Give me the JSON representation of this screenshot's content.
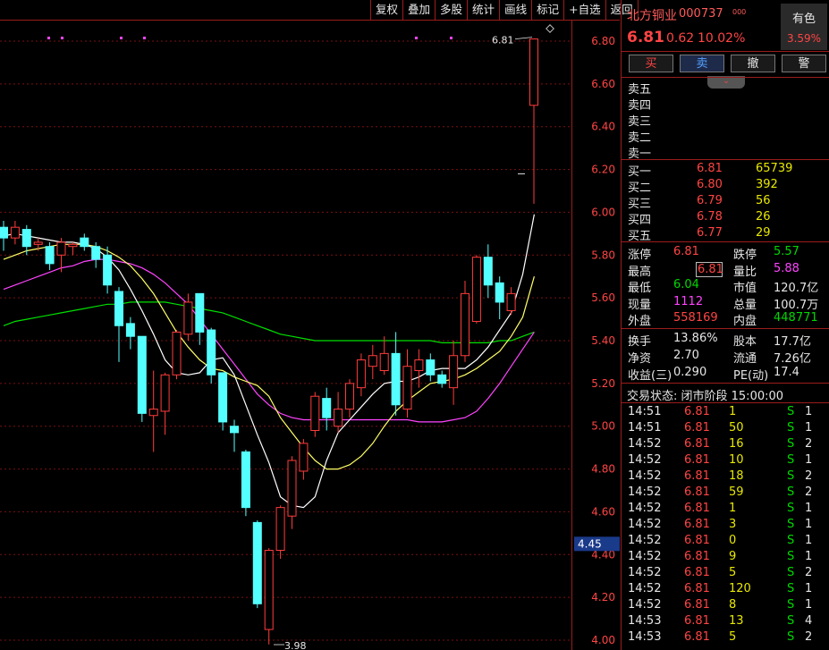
{
  "toolbar": [
    "复权",
    "叠加",
    "多股",
    "统计",
    "画线",
    "标记",
    "+自选",
    "返回"
  ],
  "stock": {
    "name": "北方铜业",
    "code": "000737",
    "sup": "000",
    "price": "6.81",
    "change": "0.62",
    "pct": "10.02%",
    "tag_label": "有色",
    "tag_pct": "3.59%"
  },
  "trade_buttons": [
    "买",
    "卖",
    "撤",
    "警"
  ],
  "sell_levels": [
    "卖五",
    "卖四",
    "卖三",
    "卖二",
    "卖一"
  ],
  "buy_levels": [
    {
      "label": "买一",
      "price": "6.81",
      "vol": "65739"
    },
    {
      "label": "买二",
      "price": "6.80",
      "vol": "392"
    },
    {
      "label": "买三",
      "price": "6.79",
      "vol": "56"
    },
    {
      "label": "买四",
      "price": "6.78",
      "vol": "26"
    },
    {
      "label": "买五",
      "price": "6.77",
      "vol": "29"
    }
  ],
  "stats": [
    {
      "l1": "涨停",
      "v1": "6.81",
      "c1": "red",
      "l2": "跌停",
      "v2": "5.57",
      "c2": "green"
    },
    {
      "l1": "最高",
      "v1": "6.81",
      "c1": "red",
      "l2": "量比",
      "v2": "5.88",
      "c2": "mag",
      "box": true
    },
    {
      "l1": "最低",
      "v1": "6.04",
      "c1": "green",
      "l2": "市值",
      "v2": "120.7亿",
      "c2": "white"
    },
    {
      "l1": "现量",
      "v1": "1112",
      "c1": "mag",
      "l2": "总量",
      "v2": "100.7万",
      "c2": "white"
    },
    {
      "l1": "外盘",
      "v1": "558169",
      "c1": "red",
      "l2": "内盘",
      "v2": "448771",
      "c2": "green"
    }
  ],
  "stats2": [
    {
      "l1": "换手",
      "v1": "13.86%",
      "l2": "股本",
      "v2": "17.7亿"
    },
    {
      "l1": "净资",
      "v1": "2.70",
      "l2": "流通",
      "v2": "7.26亿"
    },
    {
      "l1": "收益(三)",
      "v1": "0.290",
      "l2": "PE(动)",
      "v2": "17.4"
    }
  ],
  "trade_status": "交易状态: 闭市阶段 15:00:00",
  "ticks": [
    [
      "14:51",
      "6.81",
      "1",
      "S",
      "1"
    ],
    [
      "14:51",
      "6.81",
      "50",
      "S",
      "1"
    ],
    [
      "14:52",
      "6.81",
      "16",
      "S",
      "2"
    ],
    [
      "14:52",
      "6.81",
      "10",
      "S",
      "1"
    ],
    [
      "14:52",
      "6.81",
      "18",
      "S",
      "2"
    ],
    [
      "14:52",
      "6.81",
      "59",
      "S",
      "2"
    ],
    [
      "14:52",
      "6.81",
      "1",
      "S",
      "1"
    ],
    [
      "14:52",
      "6.81",
      "3",
      "S",
      "1"
    ],
    [
      "14:52",
      "6.81",
      "0",
      "S",
      "1"
    ],
    [
      "14:52",
      "6.81",
      "9",
      "S",
      "1"
    ],
    [
      "14:52",
      "6.81",
      "5",
      "S",
      "2"
    ],
    [
      "14:52",
      "6.81",
      "120",
      "S",
      "1"
    ],
    [
      "14:52",
      "6.81",
      "8",
      "S",
      "1"
    ],
    [
      "14:53",
      "6.81",
      "13",
      "S",
      "4"
    ],
    [
      "14:53",
      "6.81",
      "5",
      "S",
      "2"
    ]
  ],
  "axis": {
    "ticks": [
      "6.80",
      "6.60",
      "6.40",
      "6.20",
      "6.00",
      "5.80",
      "5.60",
      "5.40",
      "5.20",
      "5.00",
      "4.80",
      "4.60",
      "4.40",
      "4.20",
      "4.00"
    ],
    "cursor_price": "4.45"
  },
  "annotations": {
    "high": "6.81",
    "low": "3.98"
  },
  "colors": {
    "up": "#ff3c3c",
    "down": "#54ffff",
    "ma1": "#ffffff",
    "ma2": "#ffff66",
    "ma3": "#ff44ff",
    "ma4": "#00e000",
    "grid": "#7a1010"
  },
  "chart_data": {
    "type": "candlestick",
    "ylim": [
      4.0,
      6.85
    ],
    "y_ticks": [
      6.8,
      6.6,
      6.4,
      6.2,
      6.0,
      5.8,
      5.6,
      5.4,
      5.2,
      5.0,
      4.8,
      4.6,
      4.4,
      4.2,
      4.0
    ],
    "candles": [
      {
        "o": 5.93,
        "c": 5.88,
        "h": 5.96,
        "l": 5.82
      },
      {
        "o": 5.88,
        "c": 5.93,
        "h": 5.96,
        "l": 5.85
      },
      {
        "o": 5.92,
        "c": 5.84,
        "h": 5.94,
        "l": 5.8
      },
      {
        "o": 5.85,
        "c": 5.86,
        "h": 5.88,
        "l": 5.82
      },
      {
        "o": 5.84,
        "c": 5.76,
        "h": 5.86,
        "l": 5.73
      },
      {
        "o": 5.8,
        "c": 5.86,
        "h": 5.88,
        "l": 5.72
      },
      {
        "o": 5.84,
        "c": 5.85,
        "h": 5.86,
        "l": 5.8
      },
      {
        "o": 5.88,
        "c": 5.84,
        "h": 5.9,
        "l": 5.82
      },
      {
        "o": 5.84,
        "c": 5.78,
        "h": 5.86,
        "l": 5.74
      },
      {
        "o": 5.8,
        "c": 5.66,
        "h": 5.84,
        "l": 5.62
      },
      {
        "o": 5.63,
        "c": 5.47,
        "h": 5.65,
        "l": 5.3
      },
      {
        "o": 5.48,
        "c": 5.42,
        "h": 5.51,
        "l": 5.36
      },
      {
        "o": 5.42,
        "c": 5.06,
        "h": 5.42,
        "l": 5.02
      },
      {
        "o": 5.05,
        "c": 5.08,
        "h": 5.26,
        "l": 4.88
      },
      {
        "o": 5.07,
        "c": 5.24,
        "h": 5.25,
        "l": 4.96
      },
      {
        "o": 5.24,
        "c": 5.44,
        "h": 5.45,
        "l": 5.22
      },
      {
        "o": 5.43,
        "c": 5.58,
        "h": 5.62,
        "l": 5.4
      },
      {
        "o": 5.62,
        "c": 5.44,
        "h": 5.62,
        "l": 5.38
      },
      {
        "o": 5.45,
        "c": 5.24,
        "h": 5.46,
        "l": 5.2
      },
      {
        "o": 5.25,
        "c": 5.02,
        "h": 5.25,
        "l": 4.98
      },
      {
        "o": 5.0,
        "c": 4.97,
        "h": 5.03,
        "l": 4.88
      },
      {
        "o": 4.88,
        "c": 4.62,
        "h": 4.89,
        "l": 4.58
      },
      {
        "o": 4.55,
        "c": 4.17,
        "h": 4.56,
        "l": 4.15
      },
      {
        "o": 4.05,
        "c": 4.42,
        "h": 4.43,
        "l": 3.98
      },
      {
        "o": 4.42,
        "c": 4.62,
        "h": 4.63,
        "l": 4.38
      },
      {
        "o": 4.58,
        "c": 4.84,
        "h": 4.86,
        "l": 4.52
      },
      {
        "o": 4.79,
        "c": 4.92,
        "h": 4.94,
        "l": 4.75
      },
      {
        "o": 4.98,
        "c": 5.14,
        "h": 5.16,
        "l": 4.95
      },
      {
        "o": 5.13,
        "c": 5.04,
        "h": 5.18,
        "l": 4.98
      },
      {
        "o": 5.0,
        "c": 5.08,
        "h": 5.16,
        "l": 4.97
      },
      {
        "o": 5.08,
        "c": 5.2,
        "h": 5.22,
        "l": 5.04
      },
      {
        "o": 5.18,
        "c": 5.31,
        "h": 5.34,
        "l": 5.14
      },
      {
        "o": 5.28,
        "c": 5.33,
        "h": 5.38,
        "l": 5.22
      },
      {
        "o": 5.26,
        "c": 5.34,
        "h": 5.42,
        "l": 5.24
      },
      {
        "o": 5.34,
        "c": 5.1,
        "h": 5.44,
        "l": 5.05
      },
      {
        "o": 5.08,
        "c": 5.28,
        "h": 5.36,
        "l": 5.04
      },
      {
        "o": 5.26,
        "c": 5.31,
        "h": 5.36,
        "l": 5.18
      },
      {
        "o": 5.31,
        "c": 5.24,
        "h": 5.34,
        "l": 5.21
      },
      {
        "o": 5.24,
        "c": 5.2,
        "h": 5.26,
        "l": 5.18
      },
      {
        "o": 5.18,
        "c": 5.33,
        "h": 5.4,
        "l": 5.1
      },
      {
        "o": 5.33,
        "c": 5.62,
        "h": 5.68,
        "l": 5.3
      },
      {
        "o": 5.49,
        "c": 5.79,
        "h": 5.8,
        "l": 5.48
      },
      {
        "o": 5.79,
        "c": 5.66,
        "h": 5.85,
        "l": 5.6
      },
      {
        "o": 5.67,
        "c": 5.58,
        "h": 5.7,
        "l": 5.5
      },
      {
        "o": 5.54,
        "c": 5.62,
        "h": 5.65,
        "l": 5.52
      },
      {
        "o": 6.5,
        "c": 6.81,
        "h": 6.81,
        "l": 6.04
      }
    ],
    "ma1": [
      5.89,
      5.9,
      5.89,
      5.88,
      5.87,
      5.86,
      5.86,
      5.85,
      5.83,
      5.79,
      5.73,
      5.64,
      5.54,
      5.43,
      5.31,
      5.25,
      5.24,
      5.25,
      5.31,
      5.32,
      5.24,
      5.1,
      4.96,
      4.83,
      4.67,
      4.63,
      4.62,
      4.67,
      4.84,
      4.97,
      5.03,
      5.09,
      5.15,
      5.2,
      5.21,
      5.21,
      5.23,
      5.26,
      5.27,
      5.27,
      5.27,
      5.31,
      5.37,
      5.45,
      5.53,
      5.71,
      5.99
    ],
    "ma2": [
      5.78,
      5.8,
      5.82,
      5.83,
      5.84,
      5.85,
      5.85,
      5.85,
      5.84,
      5.82,
      5.79,
      5.75,
      5.69,
      5.62,
      5.53,
      5.44,
      5.37,
      5.31,
      5.27,
      5.26,
      5.23,
      5.21,
      5.19,
      5.14,
      5.04,
      4.97,
      4.9,
      4.84,
      4.8,
      4.8,
      4.82,
      4.86,
      4.92,
      5.0,
      5.07,
      5.12,
      5.16,
      5.2,
      5.21,
      5.22,
      5.24,
      5.27,
      5.31,
      5.35,
      5.42,
      5.51,
      5.7
    ],
    "ma3": [
      5.64,
      5.66,
      5.68,
      5.7,
      5.72,
      5.74,
      5.75,
      5.77,
      5.78,
      5.78,
      5.77,
      5.76,
      5.74,
      5.71,
      5.67,
      5.62,
      5.57,
      5.5,
      5.43,
      5.36,
      5.29,
      5.22,
      5.15,
      5.1,
      5.06,
      5.04,
      5.03,
      5.03,
      5.03,
      5.03,
      5.03,
      5.03,
      5.03,
      5.03,
      5.03,
      5.03,
      5.02,
      5.02,
      5.02,
      5.03,
      5.04,
      5.07,
      5.13,
      5.2,
      5.28,
      5.36,
      5.44
    ],
    "ma4": [
      5.47,
      5.49,
      5.5,
      5.51,
      5.52,
      5.53,
      5.54,
      5.55,
      5.56,
      5.57,
      5.57,
      5.58,
      5.58,
      5.58,
      5.58,
      5.57,
      5.56,
      5.55,
      5.54,
      5.53,
      5.51,
      5.49,
      5.47,
      5.45,
      5.43,
      5.42,
      5.41,
      5.4,
      5.4,
      5.4,
      5.4,
      5.4,
      5.4,
      5.4,
      5.4,
      5.4,
      5.4,
      5.4,
      5.39,
      5.39,
      5.39,
      5.39,
      5.39,
      5.4,
      5.4,
      5.42,
      5.44
    ]
  }
}
